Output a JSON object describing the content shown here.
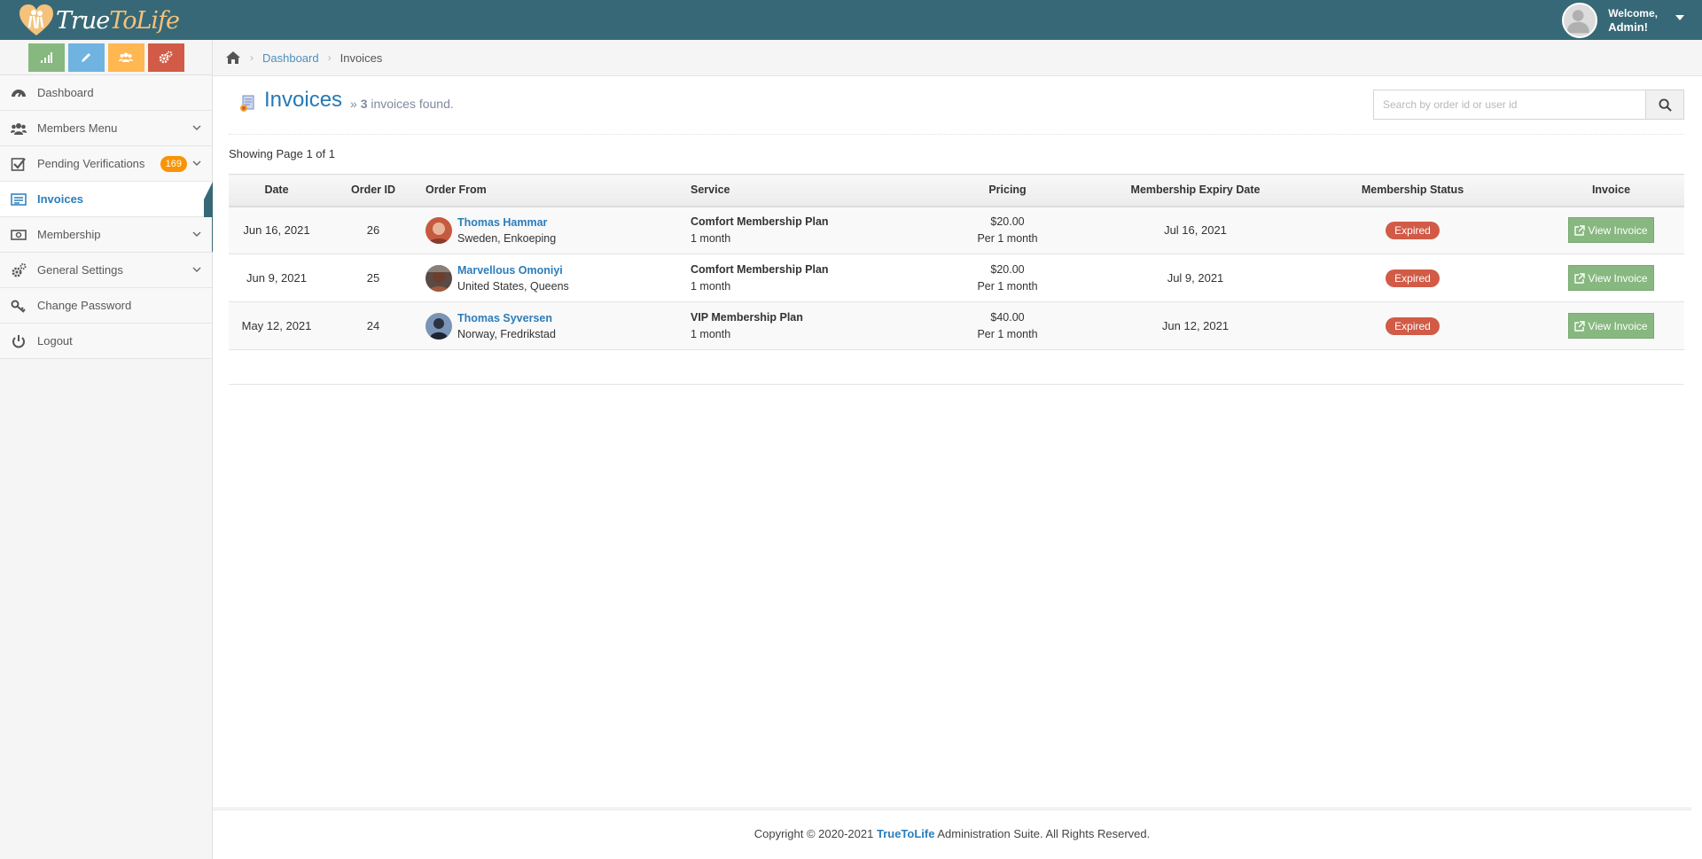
{
  "brand": {
    "logo_part1": "True",
    "logo_part2": "To",
    "logo_part3": "Life"
  },
  "user": {
    "welcome": "Welcome,",
    "name": "Admin!"
  },
  "sidebar": {
    "items": [
      {
        "label": "Dashboard",
        "icon": "dashboard-icon"
      },
      {
        "label": "Members Menu",
        "icon": "users-icon"
      },
      {
        "label": "Pending Verifications",
        "icon": "check-square-icon",
        "badge": "169"
      },
      {
        "label": "Invoices",
        "icon": "list-icon"
      },
      {
        "label": "Membership",
        "icon": "money-icon"
      },
      {
        "label": "General Settings",
        "icon": "cogs-icon"
      },
      {
        "label": "Change Password",
        "icon": "key-icon"
      },
      {
        "label": "Logout",
        "icon": "power-icon"
      }
    ]
  },
  "breadcrumb": {
    "home_icon": "home-icon",
    "parent": "Dashboard",
    "current": "Invoices"
  },
  "header": {
    "title": "Invoices",
    "count": "3",
    "count_suffix": "invoices found."
  },
  "search": {
    "placeholder": "Search by order id or user id",
    "value": ""
  },
  "showing": "Showing Page 1 of 1",
  "table": {
    "columns": [
      "Date",
      "Order ID",
      "Order From",
      "Service",
      "Pricing",
      "Membership Expiry Date",
      "Membership Status",
      "Invoice"
    ],
    "rows": [
      {
        "date": "Jun 16, 2021",
        "order_id": "26",
        "name": "Thomas Hammar",
        "location": "Sweden, Enkoeping",
        "service": "Comfort Membership Plan",
        "duration": "1 month",
        "price": "$20.00",
        "per": "Per 1 month",
        "expiry": "Jul 16, 2021",
        "status": "Expired",
        "action": "View Invoice"
      },
      {
        "date": "Jun 9, 2021",
        "order_id": "25",
        "name": "Marvellous Omoniyi",
        "location": "United States, Queens",
        "service": "Comfort Membership Plan",
        "duration": "1 month",
        "price": "$20.00",
        "per": "Per 1 month",
        "expiry": "Jul 9, 2021",
        "status": "Expired",
        "action": "View Invoice"
      },
      {
        "date": "May 12, 2021",
        "order_id": "24",
        "name": "Thomas Syversen",
        "location": "Norway, Fredrikstad",
        "service": "VIP Membership Plan",
        "duration": "1 month",
        "price": "$40.00",
        "per": "Per 1 month",
        "expiry": "Jun 12, 2021",
        "status": "Expired",
        "action": "View Invoice"
      }
    ]
  },
  "footer": {
    "prefix": "Copyright © 2020-2021",
    "brand": "TrueToLife",
    "suffix": "Administration Suite. All Rights Reserved."
  },
  "colors": {
    "navbar": "#376877",
    "accent": "#2b7dbc",
    "status_expired": "#d15b47",
    "button_green": "#87b87f",
    "badge": "#f89406"
  }
}
